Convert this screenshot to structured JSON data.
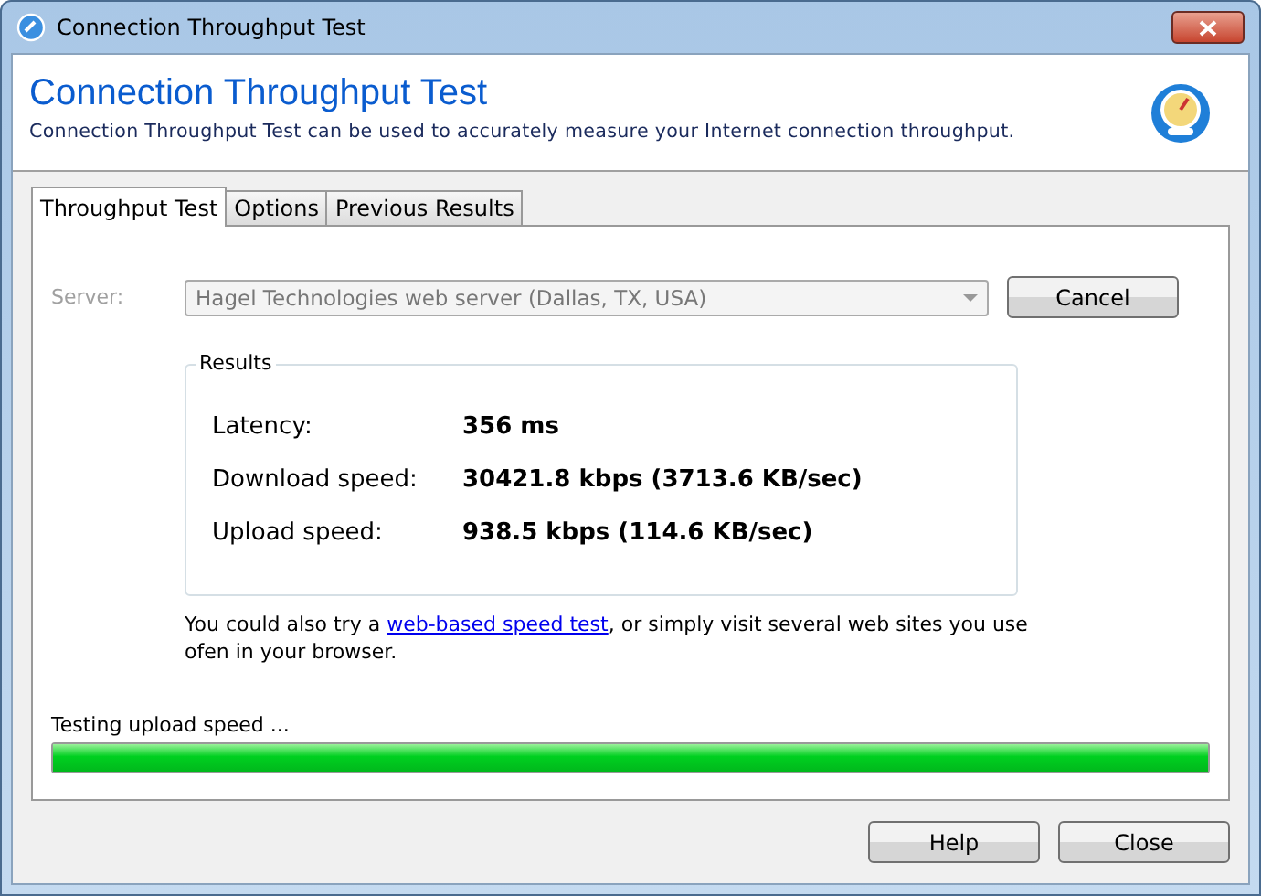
{
  "window": {
    "title": "Connection Throughput Test"
  },
  "header": {
    "title": "Connection Throughput Test",
    "subtitle": "Connection Throughput Test can be used to accurately measure your Internet connection throughput."
  },
  "tabs": [
    {
      "label": "Throughput Test",
      "selected": true
    },
    {
      "label": "Options",
      "selected": false
    },
    {
      "label": "Previous Results",
      "selected": false
    }
  ],
  "server": {
    "label": "Server:",
    "value": "Hagel Technologies web server (Dallas, TX, USA)",
    "disabled": true
  },
  "cancel_button": "Cancel",
  "results": {
    "title": "Results",
    "rows": [
      {
        "label": "Latency:",
        "value": "356 ms"
      },
      {
        "label": "Download speed:",
        "value": "30421.8 kbps (3713.6 KB/sec)"
      },
      {
        "label": "Upload speed:",
        "value": "938.5 kbps (114.6 KB/sec)"
      }
    ]
  },
  "note": {
    "before": "You could also try a ",
    "link": "web-based speed test",
    "after": ", or simply visit several web sites you use ofen in your browser."
  },
  "progress": {
    "label": "Testing upload speed ...",
    "level": 1.0
  },
  "buttons": [
    "Help",
    "Close"
  ]
}
